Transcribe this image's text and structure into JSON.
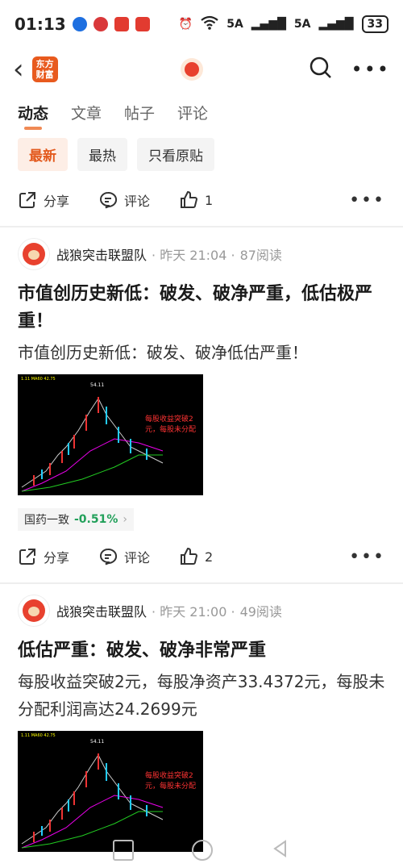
{
  "status_bar": {
    "time": "01:13",
    "battery": "33",
    "net1": "5A",
    "net2": "5A"
  },
  "header": {
    "logo_line1": "东方",
    "logo_line2": "财富"
  },
  "tabs": [
    {
      "label": "动态"
    },
    {
      "label": "文章"
    },
    {
      "label": "帖子"
    },
    {
      "label": "评论"
    }
  ],
  "filters": [
    {
      "label": "最新"
    },
    {
      "label": "最热"
    },
    {
      "label": "只看原贴"
    }
  ],
  "top_actions": {
    "share": "分享",
    "comment": "评论",
    "like_count": "1"
  },
  "posts": [
    {
      "author": "战狼突击联盟队",
      "time": "· 昨天 21:04 ·",
      "reads": "87阅读",
      "title": "市值创历史新低：破发、破净严重，低估极严重！",
      "body": "市值创历史新低：破发、破净低估严重！",
      "chart_text_1": "每股收益突破2",
      "chart_text_2": "元，每股未分配",
      "chart_legend": "1.11 MA60 42.75",
      "chart_peak": "54.11",
      "stock_name": "国药一致",
      "stock_change": "-0.51%",
      "share": "分享",
      "comment": "评论",
      "like_count": "2"
    },
    {
      "author": "战狼突击联盟队",
      "time": "· 昨天 21:00 ·",
      "reads": "49阅读",
      "title": "低估严重：破发、破净非常严重",
      "body": "每股收益突破2元，每股净资产33.4372元，每股未分配利润高达24.2699元",
      "chart_text_1": "每股收益突破2",
      "chart_text_2": "元，每股未分配",
      "chart_legend": "1.11 MA60 42.75",
      "chart_peak": "54.11"
    }
  ]
}
